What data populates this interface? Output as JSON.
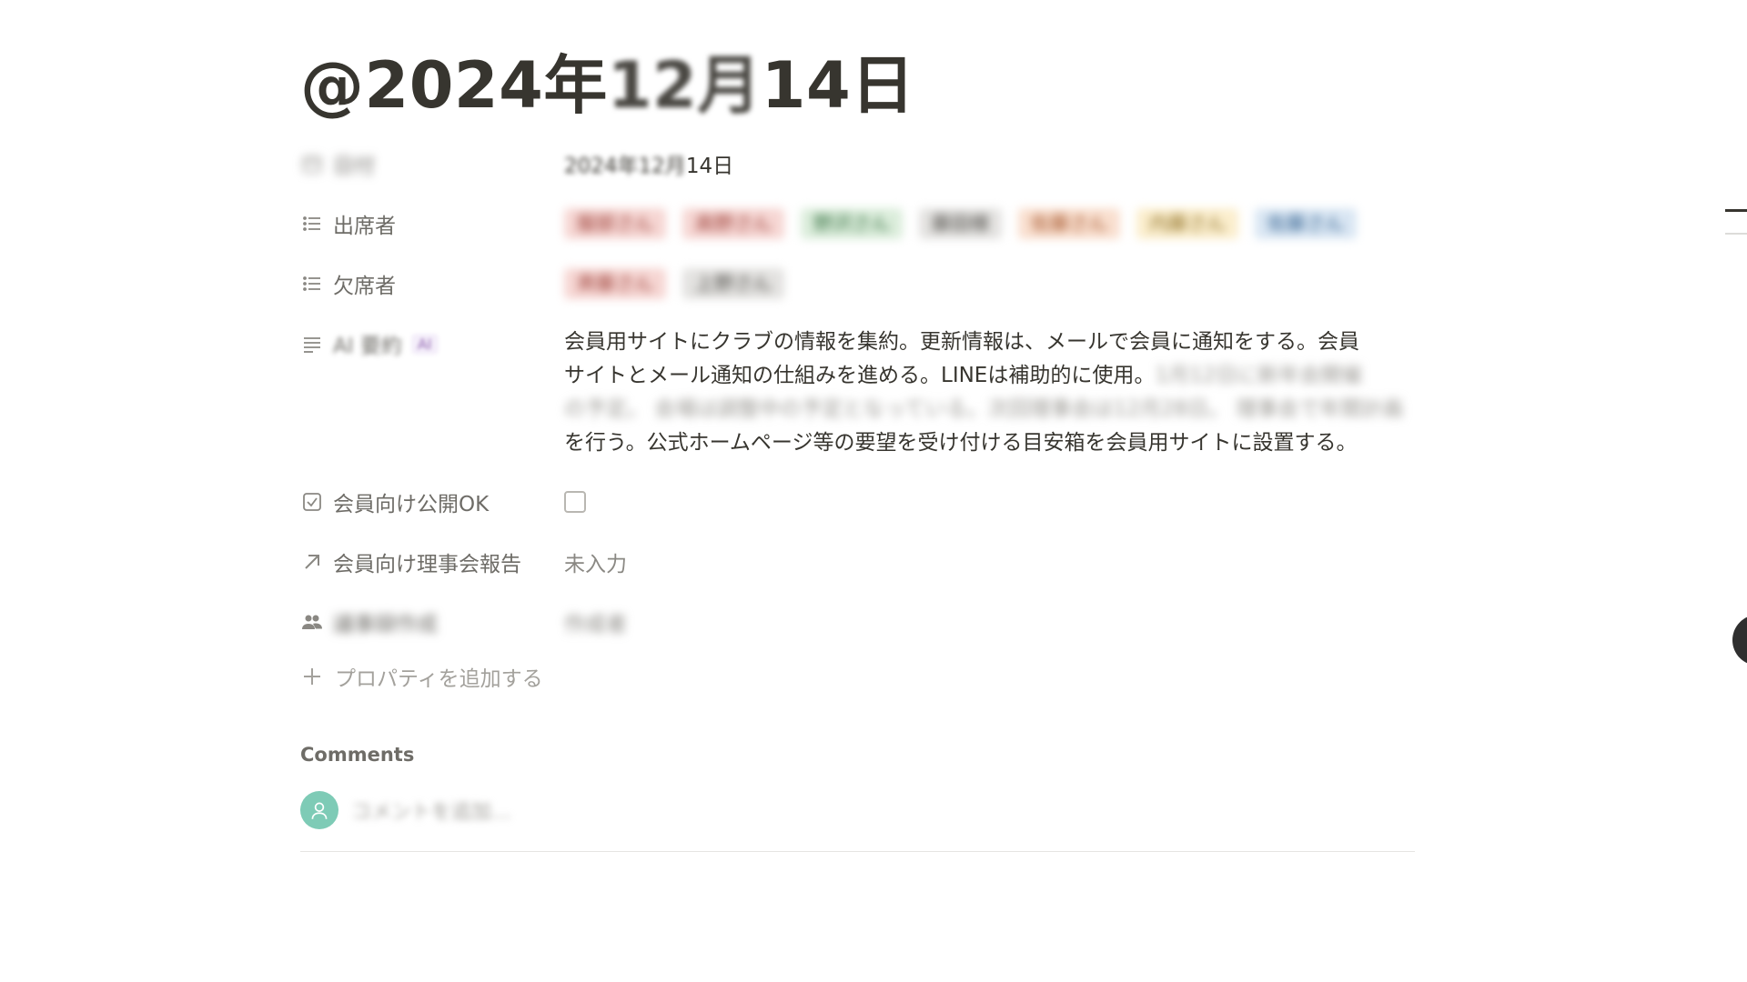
{
  "page": {
    "title_clear_start": "@2024年",
    "title_blurred": "12月",
    "title_clear_end": "14日"
  },
  "properties": {
    "date": {
      "label": "日付",
      "value_blurred": "2024年12月",
      "value_clear": "14日",
      "icon": "calendar-icon"
    },
    "attendees": {
      "label": "出席者",
      "icon": "list-icon",
      "tags": [
        {
          "text": "服部さん",
          "bg": "#f6d6d3",
          "color": "#9a3b33"
        },
        {
          "text": "高野さん",
          "bg": "#f6d6d3",
          "color": "#9a3b33"
        },
        {
          "text": "野沢さん",
          "bg": "#dbeddb",
          "color": "#2f6b3b"
        },
        {
          "text": "藤田様",
          "bg": "#e3e2e0",
          "color": "#4a4843"
        },
        {
          "text": "佐藤さん",
          "bg": "#f9dfcf",
          "color": "#a14f23"
        },
        {
          "text": "内藤さん",
          "bg": "#fbeecd",
          "color": "#8a6a1d"
        },
        {
          "text": "佐藤さん",
          "bg": "#d9e6f3",
          "color": "#2d5d8c"
        }
      ]
    },
    "absentees": {
      "label": "欠席者",
      "icon": "list-icon",
      "tags": [
        {
          "text": "斉藤さん",
          "bg": "#f6d6d3",
          "color": "#9a3b33"
        },
        {
          "text": "上野さん",
          "bg": "#e3e2e0",
          "color": "#4a4843"
        }
      ]
    },
    "ai_summary": {
      "label": "AI 要約",
      "badge": "AI",
      "icon": "text-lines-icon",
      "line1": "会員用サイトにクラブの情報を集約。更新情報は、メールで会員に通知をする。会員",
      "line2_clear": "サイトとメール通知の仕組みを進める。LINEは補助的に使用。",
      "line2_blurred": "1月12日に新年会開催",
      "line3_blurred": "の予定。 会場は調整中の予定となっている。次回理事会は12月28日。 理事会で年間計画",
      "line4": "を行う。公式ホームページ等の要望を受け付ける目安箱を会員用サイトに設置する。"
    },
    "public_ok": {
      "label": "会員向け公開OK",
      "icon": "checkbox-icon",
      "checked": false
    },
    "member_report": {
      "label": "会員向け理事会報告",
      "icon": "arrow-up-right-icon",
      "value": "未入力"
    },
    "participants": {
      "label": "議事録作成",
      "icon": "people-icon",
      "value": "作成者"
    },
    "add_property": {
      "label": "プロパティを追加する",
      "icon": "plus-icon"
    }
  },
  "comments": {
    "title": "Comments",
    "placeholder": "コメントを追加…",
    "avatar_icon": "user-avatar-icon"
  }
}
